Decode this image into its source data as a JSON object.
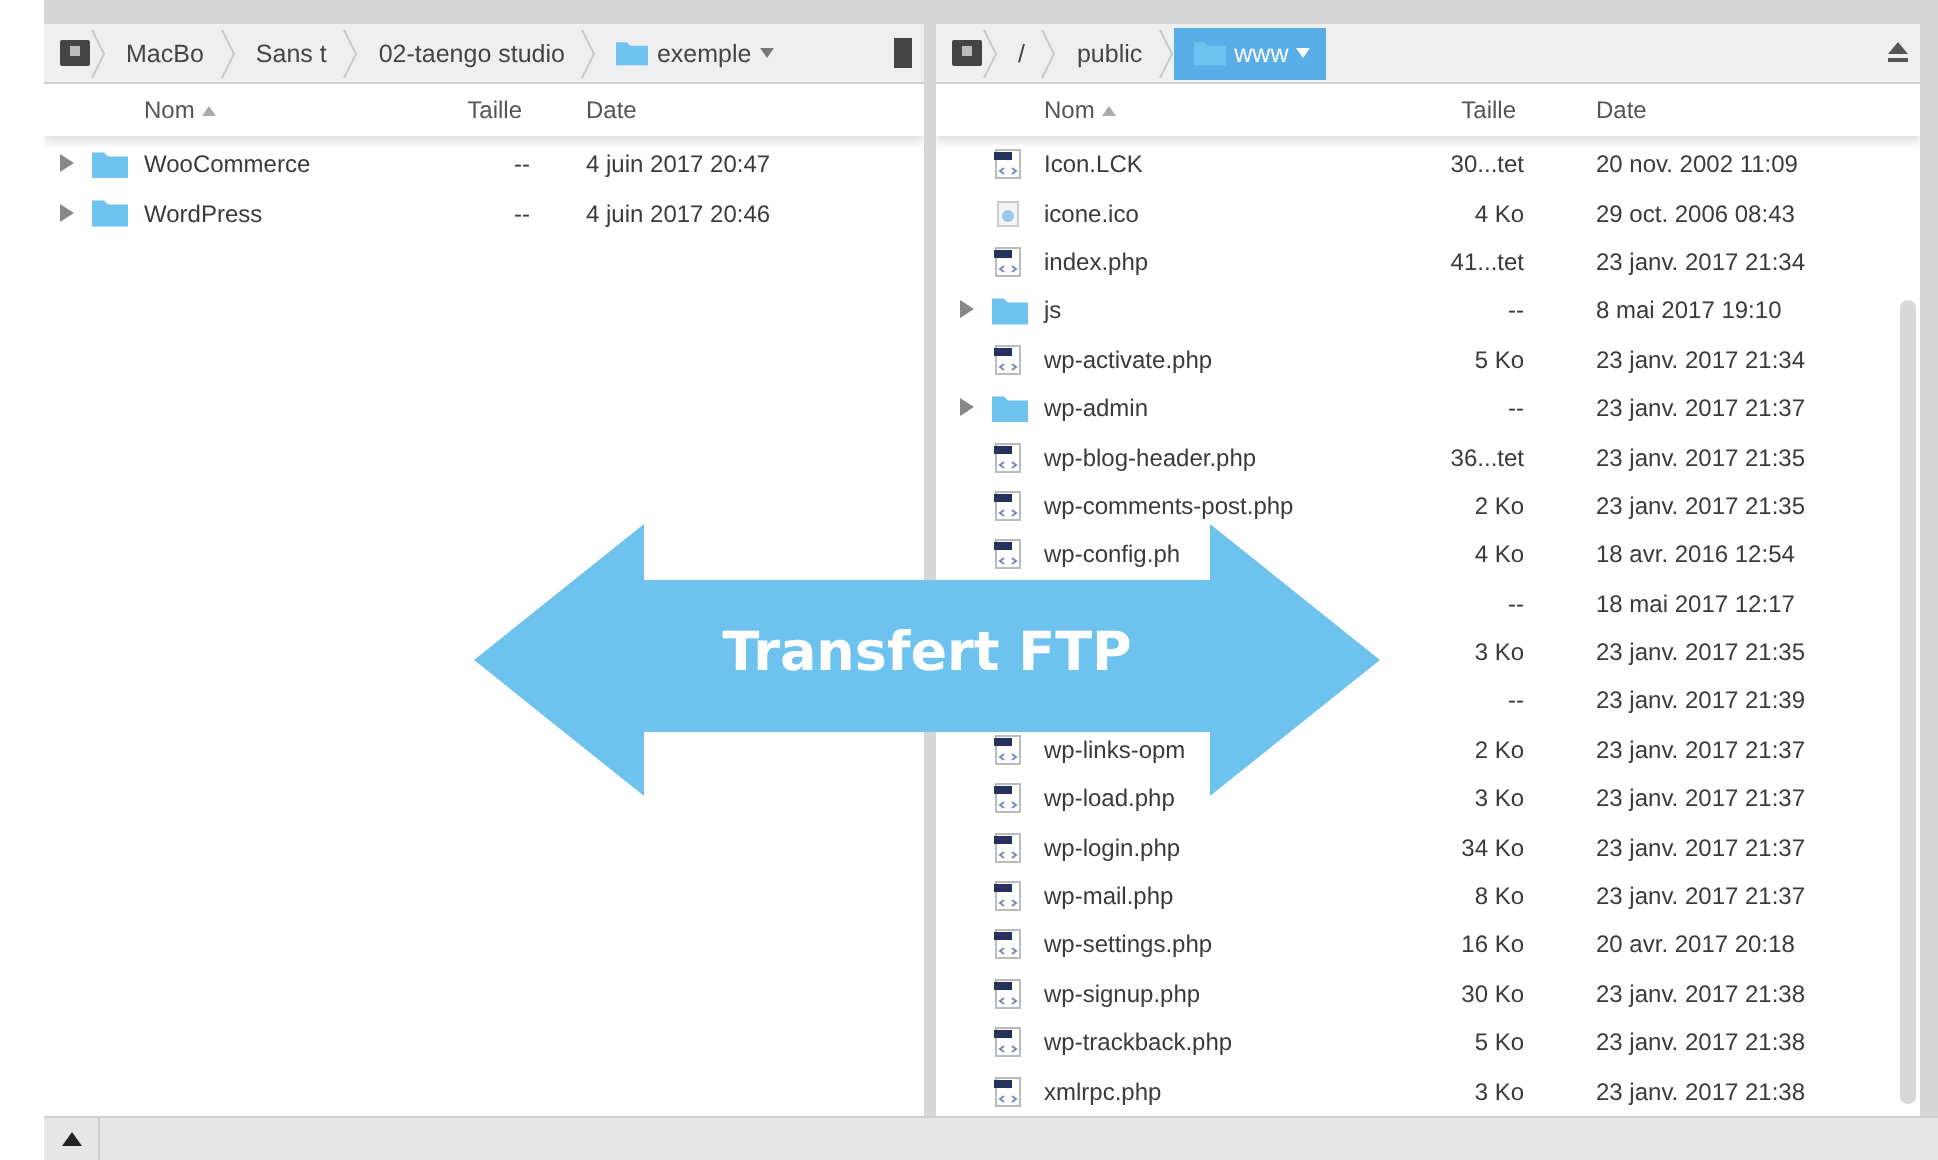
{
  "left_panel": {
    "path": [
      {
        "kind": "segment",
        "label": "MacBo",
        "selected": false
      },
      {
        "kind": "segment",
        "label": "Sans t",
        "selected": false
      },
      {
        "kind": "segment",
        "label": "02-taengo studio",
        "selected": false
      },
      {
        "kind": "folder",
        "label": "exemple",
        "selected": false,
        "dropdown": true
      }
    ],
    "end_button": {
      "kind": "disk"
    },
    "columns": [
      {
        "label": "Nom",
        "sorted": true
      },
      {
        "label": "Taille",
        "sorted": false
      },
      {
        "label": "Date",
        "sorted": false
      }
    ],
    "rows": [
      {
        "kind": "folder",
        "name": "WooCommerce",
        "size": "--",
        "date": "4 juin 2017 20:47"
      },
      {
        "kind": "folder",
        "name": "WordPress",
        "size": "--",
        "date": "4 juin 2017 20:46"
      }
    ]
  },
  "right_panel": {
    "path": [
      {
        "kind": "segment",
        "label": "/",
        "selected": false
      },
      {
        "kind": "segment",
        "label": "public",
        "selected": false
      },
      {
        "kind": "folder",
        "label": "www",
        "selected": true,
        "dropdown": true
      }
    ],
    "end_button": {
      "kind": "eject"
    },
    "columns": [
      {
        "label": "Nom",
        "sorted": true
      },
      {
        "label": "Taille",
        "sorted": false
      },
      {
        "label": "Date",
        "sorted": false
      }
    ],
    "rows": [
      {
        "kind": "file",
        "name": "Icon.LCK",
        "size": "30...tet",
        "date": "20 nov. 2002 11:09"
      },
      {
        "kind": "image",
        "name": "icone.ico",
        "size": "4 Ko",
        "date": "29 oct. 2006 08:43"
      },
      {
        "kind": "file",
        "name": "index.php",
        "size": "41...tet",
        "date": "23 janv. 2017 21:34"
      },
      {
        "kind": "folder",
        "name": "js",
        "size": "--",
        "date": "8 mai 2017 19:10"
      },
      {
        "kind": "file",
        "name": "wp-activate.php",
        "size": "5 Ko",
        "date": "23 janv. 2017 21:34"
      },
      {
        "kind": "folder",
        "name": "wp-admin",
        "size": "--",
        "date": "23 janv. 2017 21:37"
      },
      {
        "kind": "file",
        "name": "wp-blog-header.php",
        "size": "36...tet",
        "date": "23 janv. 2017 21:35"
      },
      {
        "kind": "file",
        "name": "wp-comments-post.php",
        "size": "2 Ko",
        "date": "23 janv. 2017 21:35"
      },
      {
        "kind": "file",
        "name": "wp-config.ph",
        "size": "4 Ko",
        "date": "18 avr. 2016 12:54"
      },
      {
        "kind": "covered",
        "size": "--",
        "date": "18 mai 2017 12:17"
      },
      {
        "kind": "covered",
        "size": "3 Ko",
        "date": "23 janv. 2017 21:35"
      },
      {
        "kind": "covered",
        "size": "--",
        "date": "23 janv. 2017 21:39"
      },
      {
        "kind": "file",
        "name": "wp-links-opm",
        "size": "2 Ko",
        "date": "23 janv. 2017 21:37"
      },
      {
        "kind": "file",
        "name": "wp-load.php",
        "size": "3 Ko",
        "date": "23 janv. 2017 21:37"
      },
      {
        "kind": "file",
        "name": "wp-login.php",
        "size": "34 Ko",
        "date": "23 janv. 2017 21:37"
      },
      {
        "kind": "file",
        "name": "wp-mail.php",
        "size": "8 Ko",
        "date": "23 janv. 2017 21:37"
      },
      {
        "kind": "file",
        "name": "wp-settings.php",
        "size": "16 Ko",
        "date": "20 avr. 2017 20:18"
      },
      {
        "kind": "file",
        "name": "wp-signup.php",
        "size": "30 Ko",
        "date": "23 janv. 2017 21:38"
      },
      {
        "kind": "file",
        "name": "wp-trackback.php",
        "size": "5 Ko",
        "date": "23 janv. 2017 21:38"
      },
      {
        "kind": "file",
        "name": "xmlrpc.php",
        "size": "3 Ko",
        "date": "23 janv. 2017 21:38"
      }
    ]
  },
  "overlay": {
    "label": "Transfert FTP"
  }
}
